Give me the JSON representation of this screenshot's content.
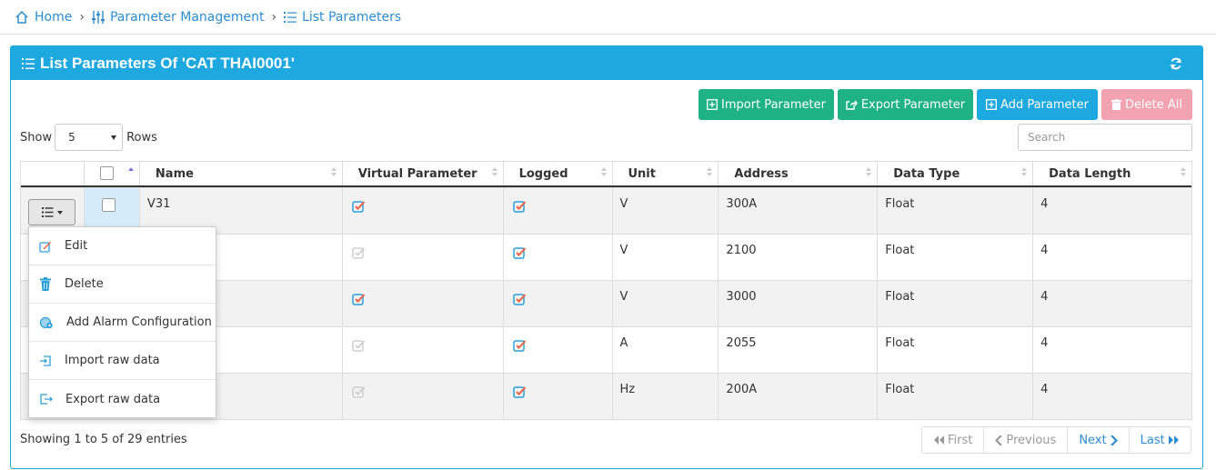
{
  "breadcrumb": {
    "home": "Home",
    "param_mgmt": "Parameter Management",
    "list": "List Parameters"
  },
  "panel": {
    "title": "List Parameters Of 'CAT THAI0001'"
  },
  "toolbar": {
    "import_label": "Import Parameter",
    "export_label": "Export Parameter",
    "add_label": "Add Parameter",
    "delete_all_label": "Delete All"
  },
  "show": {
    "prefix": "Show",
    "value": "5",
    "suffix": "Rows"
  },
  "search": {
    "placeholder": "Search"
  },
  "table": {
    "headers": [
      "Name",
      "Virtual Parameter",
      "Logged",
      "Unit",
      "Address",
      "Data Type",
      "Data Length"
    ],
    "rows": [
      {
        "name": "V31",
        "virtual": true,
        "logged": true,
        "unit": "V",
        "address": "300A",
        "type": "Float",
        "length": "4"
      },
      {
        "name": "",
        "virtual": false,
        "logged": true,
        "unit": "V",
        "address": "2100",
        "type": "Float",
        "length": "4"
      },
      {
        "name": "",
        "virtual": true,
        "logged": true,
        "unit": "V",
        "address": "3000",
        "type": "Float",
        "length": "4"
      },
      {
        "name": "",
        "virtual": false,
        "logged": true,
        "unit": "A",
        "address": "2055",
        "type": "Float",
        "length": "4"
      },
      {
        "name": "",
        "virtual": false,
        "logged": true,
        "unit": "Hz",
        "address": "200A",
        "type": "Float",
        "length": "4"
      }
    ]
  },
  "dropdown": {
    "edit": "Edit",
    "delete": "Delete",
    "alarm": "Add Alarm Configuration",
    "import_raw": "Import raw data",
    "export_raw": "Export raw data"
  },
  "footer": {
    "showing": "Showing 1 to 5 of 29 entries",
    "first": "First",
    "previous": "Previous",
    "next": "Next",
    "last": "Last"
  },
  "colors": {
    "accent": "#1ea8e0",
    "green": "#1fb384",
    "danger_disabled": "#f2a2b0",
    "link": "#2a8dd4"
  }
}
